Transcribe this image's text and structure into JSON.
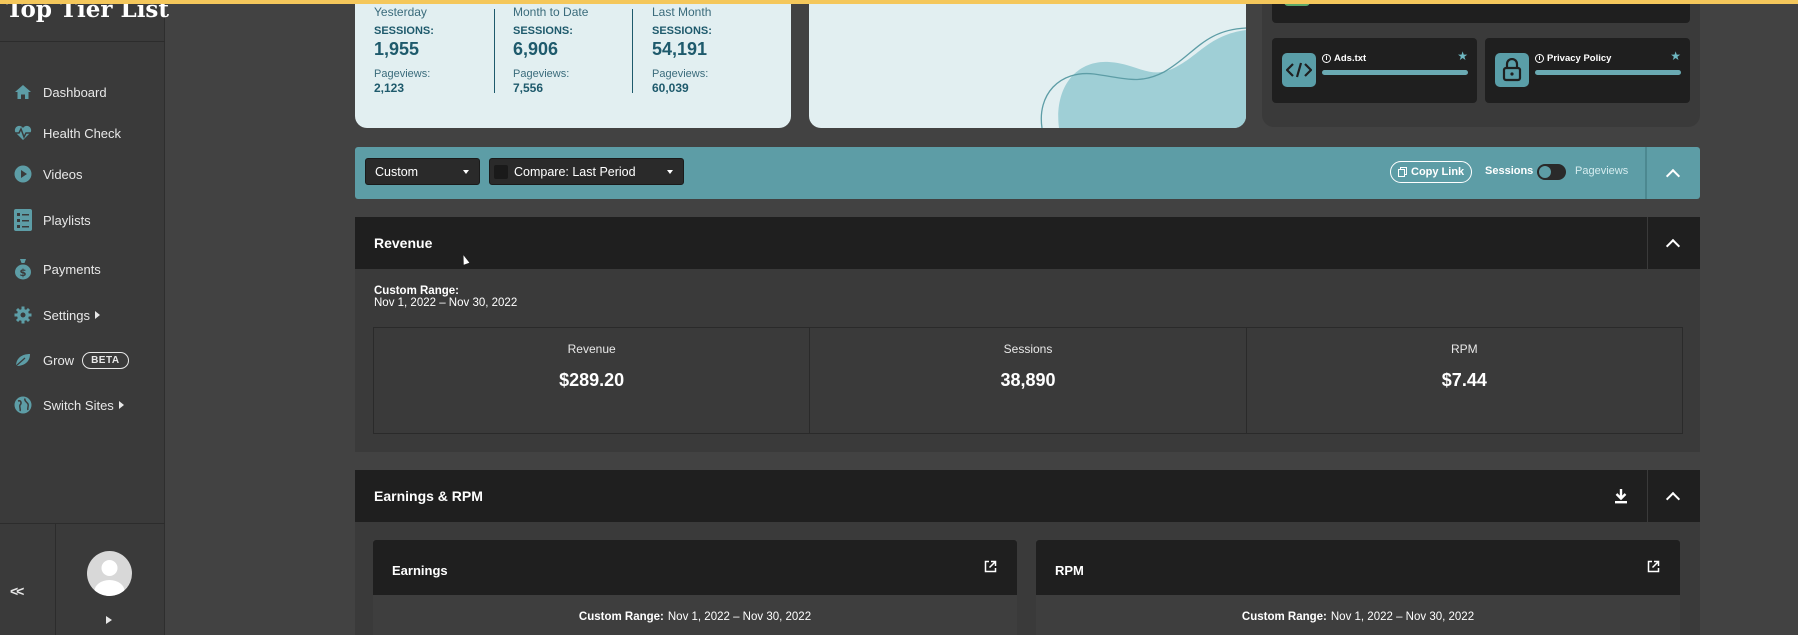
{
  "site": {
    "title": "Top Tier List"
  },
  "nav": [
    {
      "label": "Dashboard",
      "icon": "home-icon"
    },
    {
      "label": "Health Check",
      "icon": "heartbeat-icon"
    },
    {
      "label": "Videos",
      "icon": "play-circle-icon"
    },
    {
      "label": "Playlists",
      "icon": "list-icon"
    },
    {
      "label": "Payments",
      "icon": "money-bag-icon"
    },
    {
      "label": "Settings",
      "icon": "gear-icon",
      "has_submenu": true
    },
    {
      "label": "Grow",
      "icon": "leaf-icon",
      "badge": "BETA"
    },
    {
      "label": "Switch Sites",
      "icon": "globe-icon",
      "has_submenu": true
    }
  ],
  "sidebar_footer": {
    "collapse_label": "<<"
  },
  "stats": [
    {
      "period": "Yesterday",
      "sessions_label": "SESSIONS:",
      "sessions": "1,955",
      "pageviews_label": "Pageviews:",
      "pageviews": "2,123"
    },
    {
      "period": "Month to Date",
      "sessions_label": "SESSIONS:",
      "sessions": "6,906",
      "pageviews_label": "Pageviews:",
      "pageviews": "7,556"
    },
    {
      "period": "Last Month",
      "sessions_label": "SESSIONS:",
      "sessions": "54,191",
      "pageviews_label": "Pageviews:",
      "pageviews": "60,039"
    }
  ],
  "tools": [
    {
      "name": "Ads.txt",
      "icon": "code-icon"
    },
    {
      "name": "Privacy Policy",
      "icon": "lock-icon"
    }
  ],
  "filters": {
    "date_range": "Custom",
    "compare": "Compare: Last Period",
    "copy_link": "Copy Link",
    "toggle_left": "Sessions",
    "toggle_right": "Pageviews"
  },
  "revenue": {
    "title": "Revenue",
    "range_label": "Custom Range:",
    "range_value": "Nov 1, 2022 – Nov 30, 2022",
    "metrics": [
      {
        "label": "Revenue",
        "value": "$289.20"
      },
      {
        "label": "Sessions",
        "value": "38,890"
      },
      {
        "label": "RPM",
        "value": "$7.44"
      }
    ]
  },
  "earnings_rpm": {
    "title": "Earnings & RPM",
    "cards": [
      {
        "title": "Earnings",
        "range_label": "Custom Range:",
        "range_value": "Nov 1, 2022 – Nov 30, 2022"
      },
      {
        "title": "RPM",
        "range_label": "Custom Range:",
        "range_value": "Nov 1, 2022 – Nov 30, 2022"
      }
    ]
  },
  "colors": {
    "accent": "#5d9da6",
    "panel_dark": "#1f1f1f",
    "bg": "#424242",
    "card_light": "#e2eff1",
    "stat_text": "#1e5a6c",
    "topbar": "#f4c75b"
  }
}
